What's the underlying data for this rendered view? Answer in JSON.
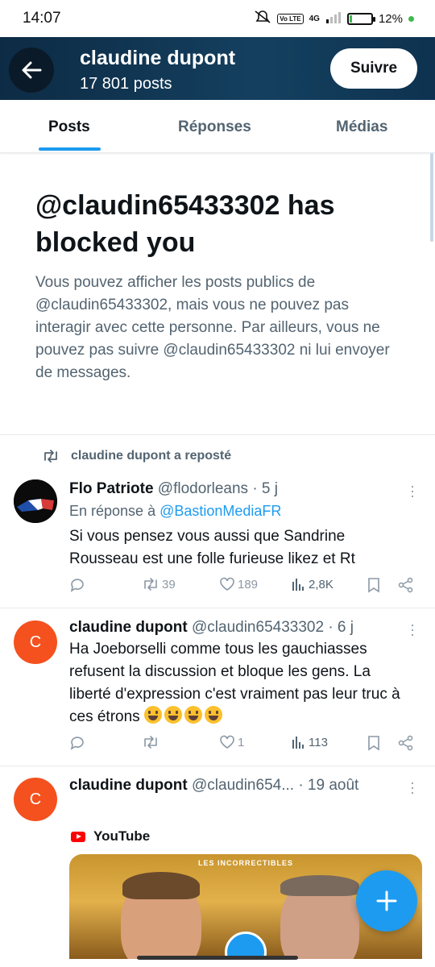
{
  "status_bar": {
    "time": "14:07",
    "network": "4G",
    "volte": "Vo LTE",
    "battery": "12%",
    "battery_level": 0.12
  },
  "header": {
    "title": "claudine dupont",
    "posts_count": "17 801 posts",
    "follow_label": "Suivre"
  },
  "tabs": [
    {
      "label": "Posts",
      "active": true
    },
    {
      "label": "Réponses",
      "active": false
    },
    {
      "label": "Médias",
      "active": false
    }
  ],
  "blocked": {
    "title": "@claudin65433302 has blocked you",
    "description": "Vous pouvez afficher les posts publics de @claudin65433302, mais vous ne pouvez pas interagir avec cette personne. Par ailleurs, vous ne pouvez pas suivre @claudin65433302 ni lui envoyer de messages."
  },
  "tweets": [
    {
      "repost_text": "claudine dupont a reposté",
      "name": "Flo Patriote",
      "handle": "@flodorleans",
      "time": "· 5 j",
      "reply_prefix": "En réponse à",
      "reply_to": "@BastionMediaFR",
      "text": "Si vous pensez vous aussi que Sandrine Rousseau est une folle furieuse likez et Rt",
      "reposts": "39",
      "likes": "189",
      "views": "2,8K"
    },
    {
      "avatar_letter": "C",
      "name": "claudine dupont",
      "handle": "@claudin65433302",
      "time": "· 6 j",
      "text": "Ha Joeborselli comme tous les gauchiasses refusent la discussion et bloque les gens. La liberté d'expression c'est vraiment pas leur truc à ces étrons",
      "reposts": "",
      "likes": "1",
      "views": "113"
    },
    {
      "avatar_letter": "C",
      "name": "claudine dupont",
      "handle": "@claudin654...",
      "time": "· 19 août",
      "card_source": "YouTube",
      "card_title": "LES INCORRECTIBLES"
    }
  ],
  "colors": {
    "accent": "#1d9bf0",
    "header_bg": "#14405f",
    "avatar_c": "#f4511e"
  },
  "icons": [
    "back-arrow-icon",
    "repost-icon",
    "reply-icon",
    "like-icon",
    "views-icon",
    "bookmark-icon",
    "share-icon",
    "more-icon",
    "youtube-icon",
    "plus-icon"
  ]
}
